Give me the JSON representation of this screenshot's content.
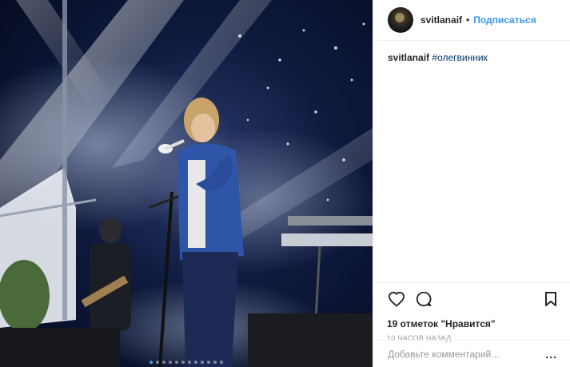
{
  "post": {
    "image_alt": "concert photo",
    "carousel": {
      "count": 12,
      "active_index": 0
    }
  },
  "header": {
    "username": "svitlanaif",
    "separator": "•",
    "follow_label": "Подписаться"
  },
  "caption": {
    "username": "svitlanaif",
    "hashtag": "#олегвинник"
  },
  "actions": {
    "like_icon": "heart-icon",
    "comment_icon": "comment-icon",
    "save_icon": "bookmark-icon",
    "likes_text": "19 отметок \"Нравится\"",
    "time_ago": "10 часов назад"
  },
  "comment_box": {
    "placeholder": "Добавьте комментарий...",
    "more_label": "..."
  },
  "colors": {
    "accent": "#3897f0",
    "hashtag": "#003569",
    "border": "#efefef"
  }
}
